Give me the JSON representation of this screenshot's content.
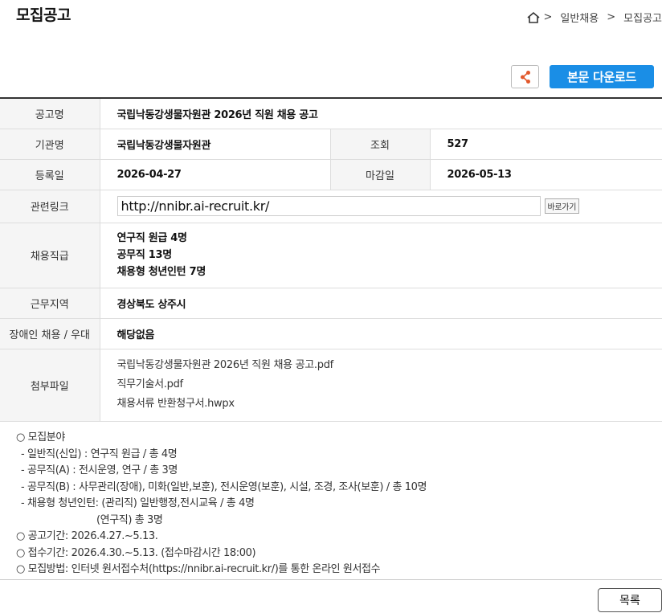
{
  "header": {
    "page_title": "모집공고",
    "breadcrumb": [
      ">",
      "일반채용",
      ">",
      "모집공고"
    ]
  },
  "actions": {
    "download_label": "본문 다운로드"
  },
  "info": {
    "notice_name_label": "공고명",
    "notice_name": "국립낙동강생물자원관 2026년 직원 채용 공고",
    "org_label": "기관명",
    "org": "국립낙동강생물자원관",
    "views_label": "조회",
    "views": "527",
    "reg_date_label": "등록일",
    "reg_date": "2026-04-27",
    "deadline_label": "마감일",
    "deadline": "2026-05-13",
    "link_label": "관련링크",
    "link": "http://nnibr.ai-recruit.kr/",
    "goto_label": "바로가기",
    "position_label": "채용직급",
    "positions": [
      "연구직 원급 4명",
      "공무직 13명",
      "채용형 청년인턴 7명"
    ],
    "region_label": "근무지역",
    "region": "경상북도 상주시",
    "disabled_label": "장애인 채용 / 우대",
    "disabled": "해당없음",
    "files_label": "첨부파일",
    "files": [
      "국립낙동강생물자원관 2026년 직원 채용 공고.pdf",
      "직무기술서.pdf",
      "채용서류 반환청구서.hwpx"
    ]
  },
  "notice": {
    "lines": [
      "○ 모집분야",
      "- 일반직(신입) : 연구직 원급 / 총 4명",
      "- 공무직(A) : 전시운영, 연구 / 총 3명",
      "- 공무직(B) : 사무관리(장애), 미화(일반,보훈), 전시운영(보훈), 시설, 조경, 조사(보훈) / 총 10명",
      "- 채용형 청년인턴: (관리직) 일반행정,전시교육 / 총 4명",
      "(연구직) 총 3명",
      "○ 공고기간: 2026.4.27.~5.13.",
      "○ 접수기간: 2026.4.30.~5.13. (접수마감시간 18:00)",
      "○ 모집방법: 인터넷 원서접수처(https://nnibr.ai-recruit.kr/)를 통한 온라인 원서접수"
    ]
  },
  "footer": {
    "list_label": "목록"
  }
}
